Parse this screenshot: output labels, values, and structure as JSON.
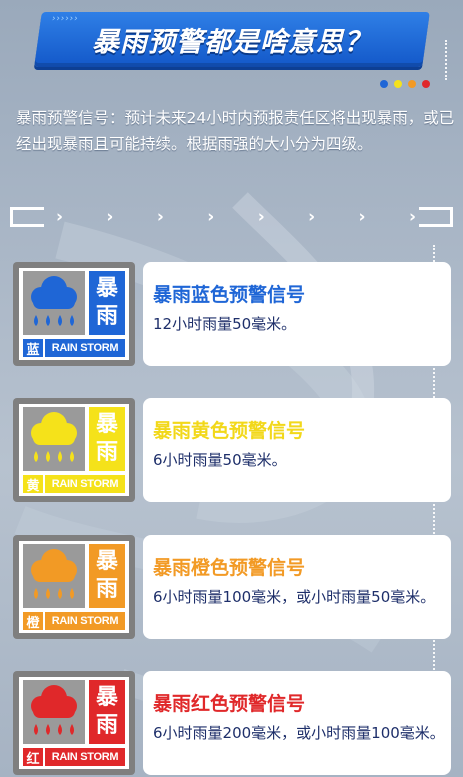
{
  "title": "暴雨预警都是啥意思？",
  "intro": "暴雨预警信号：预计未来24小时内预报责任区将出现暴雨，或已经出现暴雨且可能持续。根据雨强的大小分为四级。",
  "legend_dot_colors": [
    "#1f66d6",
    "#f5e21a",
    "#f29a25",
    "#e0282a"
  ],
  "signals": [
    {
      "char_top": "暴",
      "char_bottom": "雨",
      "level_char": "蓝",
      "english": "RAIN STORM",
      "name": "暴雨蓝色预警信号",
      "desc": "12小时雨量50毫米。",
      "color": "#1f66d6",
      "name_color": "#1f66d6"
    },
    {
      "char_top": "暴",
      "char_bottom": "雨",
      "level_char": "黄",
      "english": "RAIN STORM",
      "name": "暴雨黄色预警信号",
      "desc": "6小时雨量50毫米。",
      "color": "#f5e21a",
      "name_color": "#f2d81a"
    },
    {
      "char_top": "暴",
      "char_bottom": "雨",
      "level_char": "橙",
      "english": "RAIN STORM",
      "name": "暴雨橙色预警信号",
      "desc": "6小时雨量100毫米，或小时雨量50毫米。",
      "color": "#f29a25",
      "name_color": "#f29a25"
    },
    {
      "char_top": "暴",
      "char_bottom": "雨",
      "level_char": "红",
      "english": "RAIN STORM",
      "name": "暴雨红色预警信号",
      "desc": "6小时雨量200毫米，或小时雨量100毫米。",
      "color": "#e0282a",
      "name_color": "#e0282a"
    }
  ]
}
